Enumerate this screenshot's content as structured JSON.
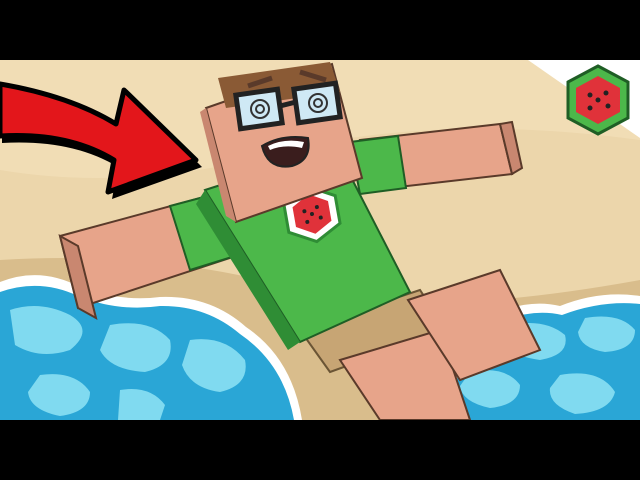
{
  "image": {
    "letterbox_color": "#000000",
    "colors": {
      "sand": "#ecd6ab",
      "sand_shade": "#d9bd8c",
      "water_deep": "#2aa6d6",
      "water_light": "#8fe3f5",
      "foam": "#ffffff",
      "skin": "#e7a48a",
      "skin_shade": "#c98770",
      "hair": "#8a5a35",
      "shirt": "#4cb84a",
      "shirt_shade": "#2f8d35",
      "shorts": "#c7a574",
      "arrow": "#e3161b",
      "watermelon_red": "#e0323a",
      "watermelon_rind": "#4cb84a"
    },
    "icons": [
      "red-arrow-icon",
      "watermelon-logo-icon",
      "shirt-watermelon-icon"
    ]
  }
}
